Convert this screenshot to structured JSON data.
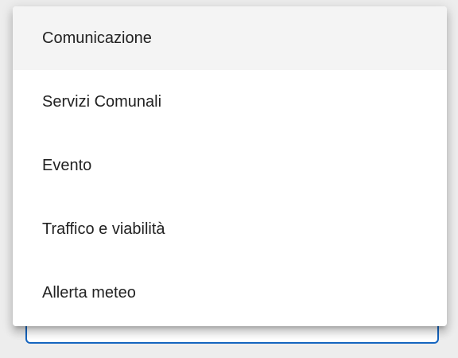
{
  "dropdown": {
    "options": [
      {
        "label": "Comunicazione",
        "highlighted": true
      },
      {
        "label": "Servizi Comunali",
        "highlighted": false
      },
      {
        "label": "Evento",
        "highlighted": false
      },
      {
        "label": "Traffico e viabilità",
        "highlighted": false
      },
      {
        "label": "Allerta meteo",
        "highlighted": false
      }
    ]
  },
  "colors": {
    "focus_border": "#1565c0",
    "highlight_bg": "#f4f4f4",
    "page_bg": "#ededed"
  }
}
